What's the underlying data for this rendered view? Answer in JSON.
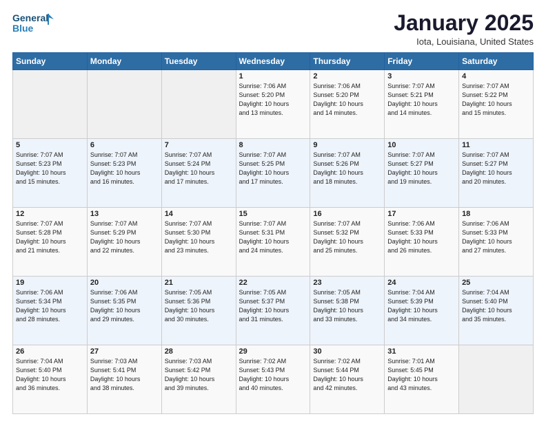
{
  "logo": {
    "line1": "General",
    "line2": "Blue"
  },
  "header": {
    "title": "January 2025",
    "location": "Iota, Louisiana, United States"
  },
  "weekdays": [
    "Sunday",
    "Monday",
    "Tuesday",
    "Wednesday",
    "Thursday",
    "Friday",
    "Saturday"
  ],
  "weeks": [
    [
      {
        "day": "",
        "info": ""
      },
      {
        "day": "",
        "info": ""
      },
      {
        "day": "",
        "info": ""
      },
      {
        "day": "1",
        "info": "Sunrise: 7:06 AM\nSunset: 5:20 PM\nDaylight: 10 hours\nand 13 minutes."
      },
      {
        "day": "2",
        "info": "Sunrise: 7:06 AM\nSunset: 5:20 PM\nDaylight: 10 hours\nand 14 minutes."
      },
      {
        "day": "3",
        "info": "Sunrise: 7:07 AM\nSunset: 5:21 PM\nDaylight: 10 hours\nand 14 minutes."
      },
      {
        "day": "4",
        "info": "Sunrise: 7:07 AM\nSunset: 5:22 PM\nDaylight: 10 hours\nand 15 minutes."
      }
    ],
    [
      {
        "day": "5",
        "info": "Sunrise: 7:07 AM\nSunset: 5:23 PM\nDaylight: 10 hours\nand 15 minutes."
      },
      {
        "day": "6",
        "info": "Sunrise: 7:07 AM\nSunset: 5:23 PM\nDaylight: 10 hours\nand 16 minutes."
      },
      {
        "day": "7",
        "info": "Sunrise: 7:07 AM\nSunset: 5:24 PM\nDaylight: 10 hours\nand 17 minutes."
      },
      {
        "day": "8",
        "info": "Sunrise: 7:07 AM\nSunset: 5:25 PM\nDaylight: 10 hours\nand 17 minutes."
      },
      {
        "day": "9",
        "info": "Sunrise: 7:07 AM\nSunset: 5:26 PM\nDaylight: 10 hours\nand 18 minutes."
      },
      {
        "day": "10",
        "info": "Sunrise: 7:07 AM\nSunset: 5:27 PM\nDaylight: 10 hours\nand 19 minutes."
      },
      {
        "day": "11",
        "info": "Sunrise: 7:07 AM\nSunset: 5:27 PM\nDaylight: 10 hours\nand 20 minutes."
      }
    ],
    [
      {
        "day": "12",
        "info": "Sunrise: 7:07 AM\nSunset: 5:28 PM\nDaylight: 10 hours\nand 21 minutes."
      },
      {
        "day": "13",
        "info": "Sunrise: 7:07 AM\nSunset: 5:29 PM\nDaylight: 10 hours\nand 22 minutes."
      },
      {
        "day": "14",
        "info": "Sunrise: 7:07 AM\nSunset: 5:30 PM\nDaylight: 10 hours\nand 23 minutes."
      },
      {
        "day": "15",
        "info": "Sunrise: 7:07 AM\nSunset: 5:31 PM\nDaylight: 10 hours\nand 24 minutes."
      },
      {
        "day": "16",
        "info": "Sunrise: 7:07 AM\nSunset: 5:32 PM\nDaylight: 10 hours\nand 25 minutes."
      },
      {
        "day": "17",
        "info": "Sunrise: 7:06 AM\nSunset: 5:33 PM\nDaylight: 10 hours\nand 26 minutes."
      },
      {
        "day": "18",
        "info": "Sunrise: 7:06 AM\nSunset: 5:33 PM\nDaylight: 10 hours\nand 27 minutes."
      }
    ],
    [
      {
        "day": "19",
        "info": "Sunrise: 7:06 AM\nSunset: 5:34 PM\nDaylight: 10 hours\nand 28 minutes."
      },
      {
        "day": "20",
        "info": "Sunrise: 7:06 AM\nSunset: 5:35 PM\nDaylight: 10 hours\nand 29 minutes."
      },
      {
        "day": "21",
        "info": "Sunrise: 7:05 AM\nSunset: 5:36 PM\nDaylight: 10 hours\nand 30 minutes."
      },
      {
        "day": "22",
        "info": "Sunrise: 7:05 AM\nSunset: 5:37 PM\nDaylight: 10 hours\nand 31 minutes."
      },
      {
        "day": "23",
        "info": "Sunrise: 7:05 AM\nSunset: 5:38 PM\nDaylight: 10 hours\nand 33 minutes."
      },
      {
        "day": "24",
        "info": "Sunrise: 7:04 AM\nSunset: 5:39 PM\nDaylight: 10 hours\nand 34 minutes."
      },
      {
        "day": "25",
        "info": "Sunrise: 7:04 AM\nSunset: 5:40 PM\nDaylight: 10 hours\nand 35 minutes."
      }
    ],
    [
      {
        "day": "26",
        "info": "Sunrise: 7:04 AM\nSunset: 5:40 PM\nDaylight: 10 hours\nand 36 minutes."
      },
      {
        "day": "27",
        "info": "Sunrise: 7:03 AM\nSunset: 5:41 PM\nDaylight: 10 hours\nand 38 minutes."
      },
      {
        "day": "28",
        "info": "Sunrise: 7:03 AM\nSunset: 5:42 PM\nDaylight: 10 hours\nand 39 minutes."
      },
      {
        "day": "29",
        "info": "Sunrise: 7:02 AM\nSunset: 5:43 PM\nDaylight: 10 hours\nand 40 minutes."
      },
      {
        "day": "30",
        "info": "Sunrise: 7:02 AM\nSunset: 5:44 PM\nDaylight: 10 hours\nand 42 minutes."
      },
      {
        "day": "31",
        "info": "Sunrise: 7:01 AM\nSunset: 5:45 PM\nDaylight: 10 hours\nand 43 minutes."
      },
      {
        "day": "",
        "info": ""
      }
    ]
  ]
}
